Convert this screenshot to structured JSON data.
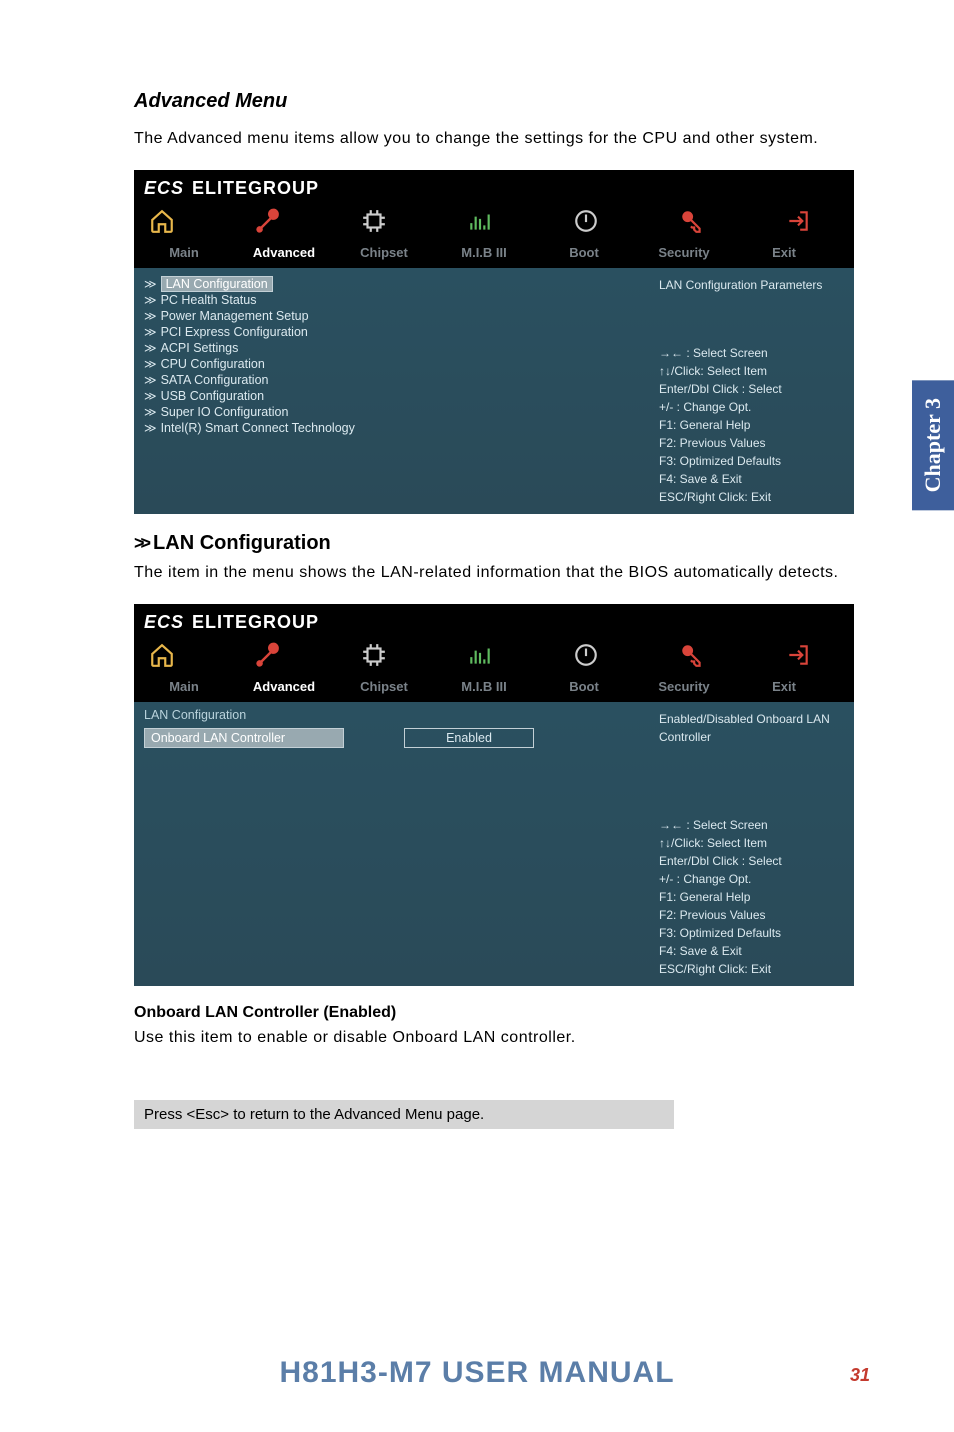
{
  "section_title": "Advanced Menu",
  "intro_text": "The Advanced menu items allow you to change the settings for the CPU and other system.",
  "bios": {
    "brand": "ELITEGROUP",
    "tabs": [
      "Main",
      "Advanced",
      "Chipset",
      "M.I.B III",
      "Boot",
      "Security",
      "Exit"
    ],
    "active_tab": "Advanced",
    "menu_items": [
      "LAN Configuration",
      "PC Health Status",
      "Power Management Setup",
      "PCI Express Configuration",
      "ACPI Settings",
      "CPU Configuration",
      "SATA Configuration",
      "USB Configuration",
      "Super IO Configuration",
      "Intel(R) Smart Connect Technology"
    ],
    "help_top": "LAN Configuration Parameters",
    "help_lines": [
      "→←   : Select Screen",
      "↑↓/Click: Select Item",
      "Enter/Dbl Click : Select",
      "+/- : Change Opt.",
      "F1: General Help",
      "F2: Previous Values",
      "F3: Optimized Defaults",
      "F4: Save & Exit",
      "ESC/Right Click: Exit"
    ]
  },
  "lan_section": {
    "heading": "LAN Configuration",
    "desc": "The item in the menu shows the LAN-related information that the BIOS automatically detects.",
    "crumb": "LAN Configuration",
    "option_label": "Onboard LAN Controller",
    "option_value": "Enabled",
    "help_top": "Enabled/Disabled Onboard LAN Controller"
  },
  "onboard_title": "Onboard LAN Controller (Enabled)",
  "onboard_desc": "Use this item to enable or disable Onboard LAN controller.",
  "note": "Press <Esc> to return to the Advanced Menu page.",
  "footer": "H81H3-M7 USER MANUAL",
  "page_number": "31",
  "side_tab": "Chapter 3"
}
